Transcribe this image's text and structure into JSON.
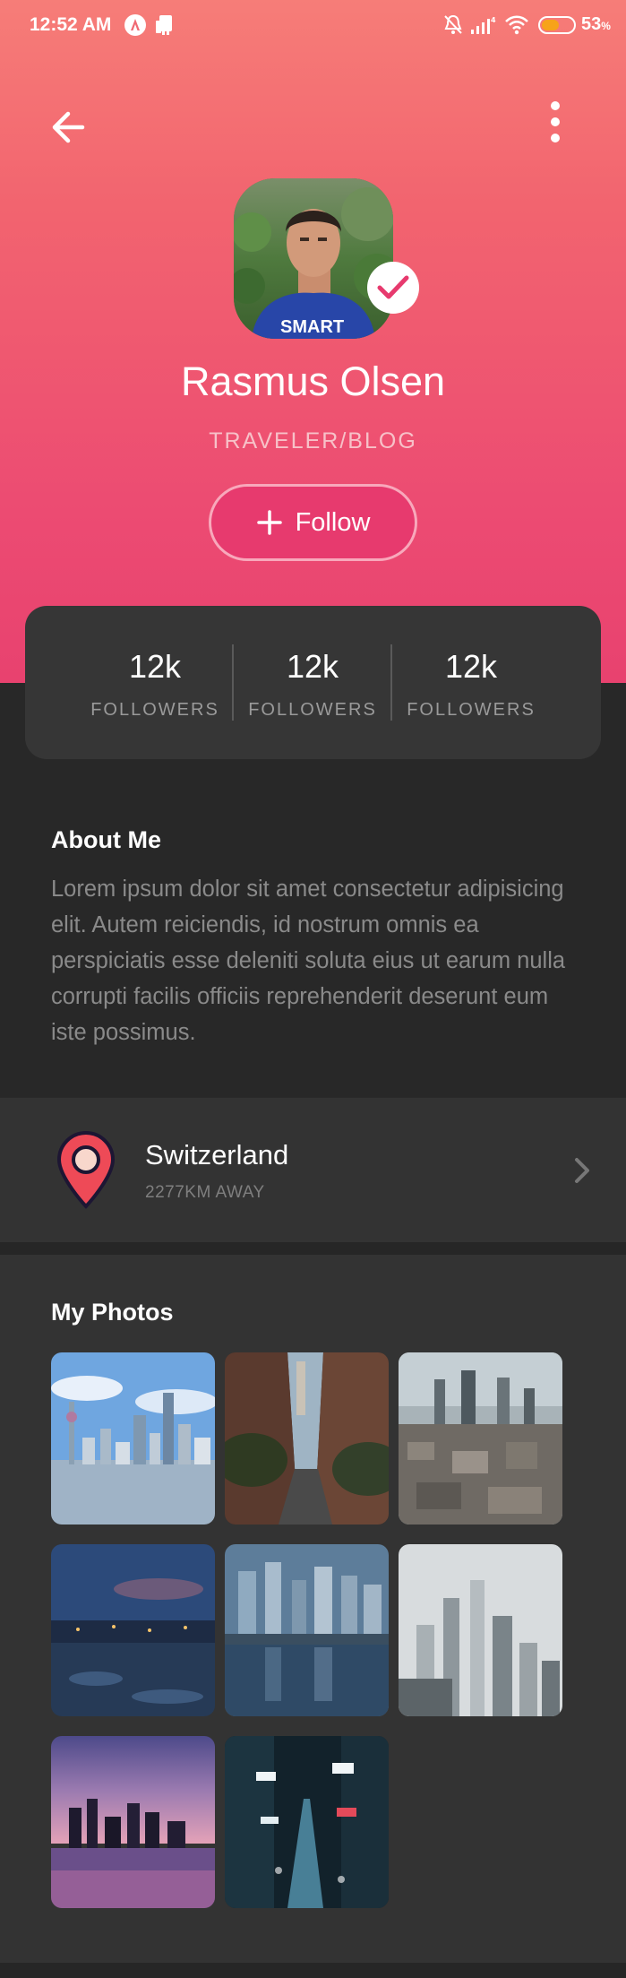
{
  "status_bar": {
    "time": "12:52 AM",
    "battery": "53",
    "battery_unit": "%"
  },
  "header": {
    "back_icon": "arrow-left-icon",
    "menu_icon": "more-vertical-icon"
  },
  "profile": {
    "name": "Rasmus Olsen",
    "subtitle": "TRAVELER/BLOG",
    "follow_label": "Follow",
    "verified_icon": "check-icon"
  },
  "stats": [
    {
      "value": "12k",
      "label": "FOLLOWERS"
    },
    {
      "value": "12k",
      "label": "FOLLOWERS"
    },
    {
      "value": "12k",
      "label": "FOLLOWERS"
    }
  ],
  "about": {
    "title": "About Me",
    "text": "Lorem ipsum dolor sit amet consectetur adipisicing elit. Autem reiciendis, id nostrum omnis ea perspiciatis esse deleniti soluta eius ut earum nulla corrupti facilis officiis reprehenderit deserunt eum iste possimus."
  },
  "location": {
    "name": "Switzerland",
    "distance": "2277KM AWAY",
    "icon": "map-pin-icon"
  },
  "photos": {
    "title": "My Photos",
    "items": [
      "shanghai-skyline-photo",
      "city-street-photo",
      "aerial-city-photo",
      "night-city-photo",
      "waterfront-city-photo",
      "foggy-city-photo",
      "sunset-skyline-photo",
      "neon-street-photo"
    ]
  },
  "colors": {
    "accent": "#e73a6e",
    "gradient_top": "#f67d78",
    "gradient_bottom": "#e8426f",
    "background": "#2a2a2a",
    "card": "#363636"
  }
}
